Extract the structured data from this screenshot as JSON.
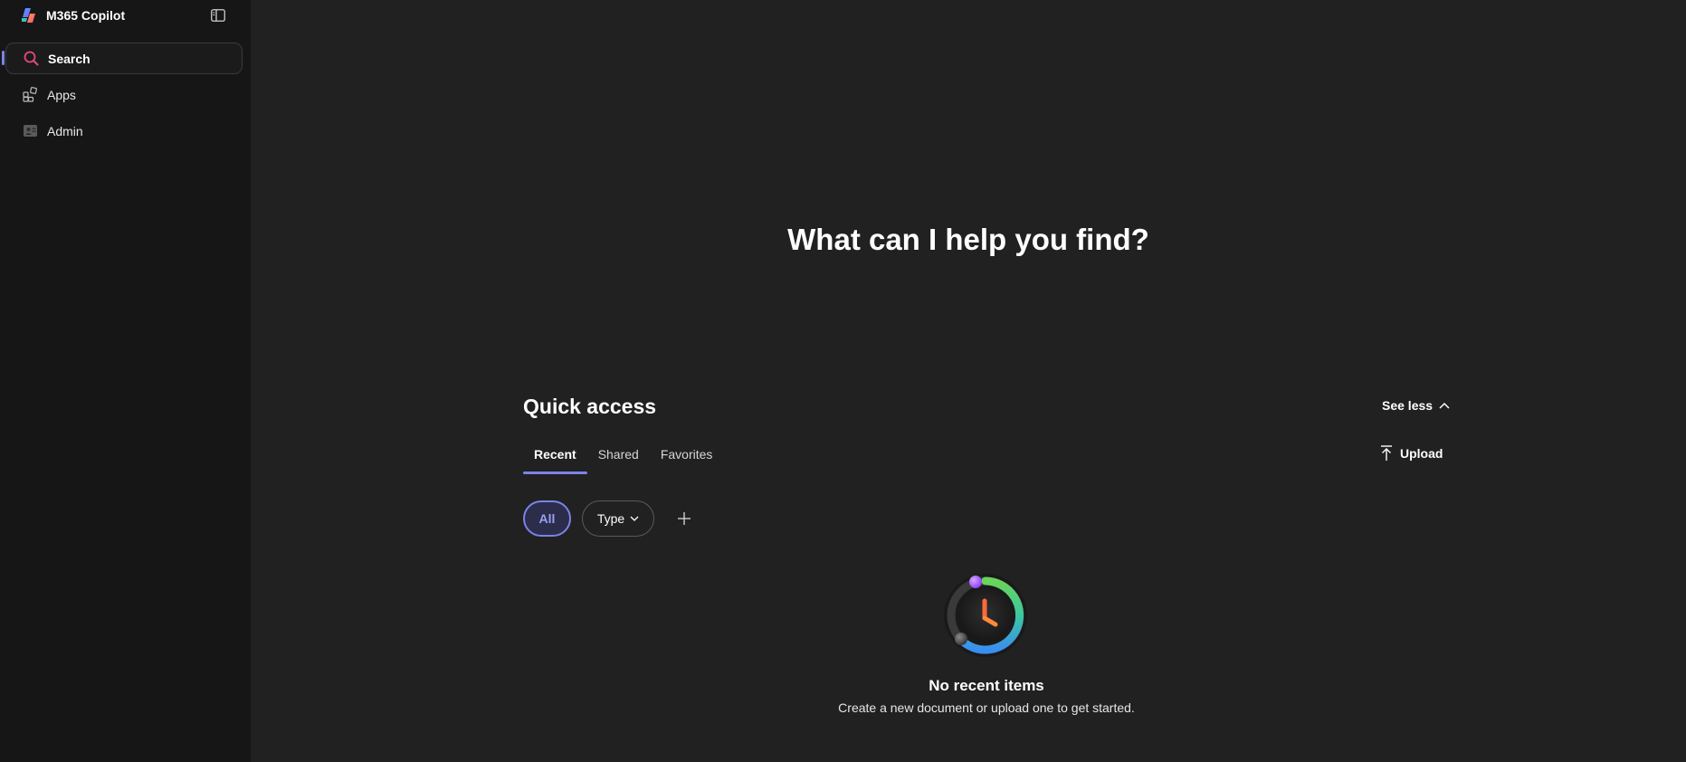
{
  "app": {
    "title": "M365 Copilot"
  },
  "sidebar": {
    "items": [
      {
        "label": "Search",
        "icon": "search-icon",
        "active": true
      },
      {
        "label": "Apps",
        "icon": "apps-icon",
        "active": false
      },
      {
        "label": "Admin",
        "icon": "admin-icon",
        "active": false
      }
    ]
  },
  "main": {
    "hero": "What can I help you find?",
    "quick_access": {
      "title": "Quick access",
      "see_less_label": "See less",
      "tabs": [
        {
          "label": "Recent",
          "active": true
        },
        {
          "label": "Shared",
          "active": false
        },
        {
          "label": "Favorites",
          "active": false
        }
      ],
      "upload_label": "Upload",
      "filters": {
        "all_label": "All",
        "type_label": "Type"
      },
      "empty_state": {
        "title": "No recent items",
        "subtitle": "Create a new document or upload one to get started."
      }
    }
  },
  "colors": {
    "background": "#212121",
    "sidebar": "#161616",
    "accent": "#7b83eb",
    "search_icon": "#e34b7a"
  }
}
